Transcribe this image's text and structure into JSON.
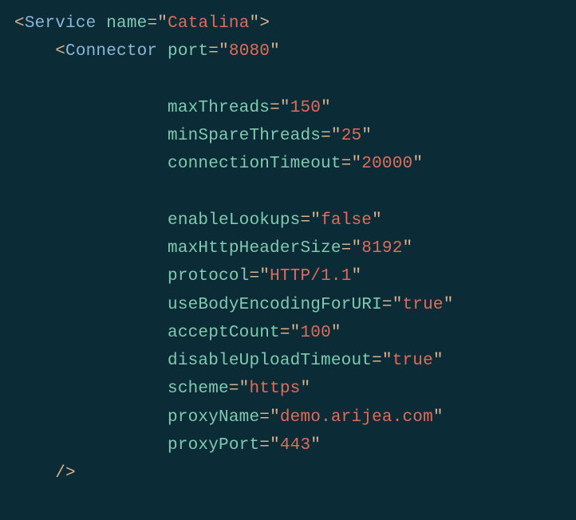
{
  "tokens": [
    {
      "cls": "p",
      "txt": "<"
    },
    {
      "cls": "t",
      "txt": "Service"
    },
    {
      "cls": "p",
      "txt": " "
    },
    {
      "cls": "a",
      "txt": "name"
    },
    {
      "cls": "p",
      "txt": "="
    },
    {
      "cls": "p",
      "txt": "\""
    },
    {
      "cls": "v",
      "txt": "Catalina"
    },
    {
      "cls": "p",
      "txt": "\""
    },
    {
      "cls": "p",
      "txt": ">"
    },
    {
      "cls": "nl",
      "txt": "\n"
    },
    {
      "cls": "p",
      "txt": "    <"
    },
    {
      "cls": "t",
      "txt": "Connector"
    },
    {
      "cls": "p",
      "txt": " "
    },
    {
      "cls": "a",
      "txt": "port"
    },
    {
      "cls": "p",
      "txt": "="
    },
    {
      "cls": "p",
      "txt": "\""
    },
    {
      "cls": "v",
      "txt": "8080"
    },
    {
      "cls": "p",
      "txt": "\""
    },
    {
      "cls": "nl",
      "txt": "\n"
    },
    {
      "cls": "nl",
      "txt": "\n"
    },
    {
      "cls": "p",
      "txt": "               "
    },
    {
      "cls": "a",
      "txt": "maxThreads"
    },
    {
      "cls": "p",
      "txt": "="
    },
    {
      "cls": "p",
      "txt": "\""
    },
    {
      "cls": "v",
      "txt": "150"
    },
    {
      "cls": "p",
      "txt": "\""
    },
    {
      "cls": "nl",
      "txt": "\n"
    },
    {
      "cls": "p",
      "txt": "               "
    },
    {
      "cls": "a",
      "txt": "minSpareThreads"
    },
    {
      "cls": "p",
      "txt": "="
    },
    {
      "cls": "p",
      "txt": "\""
    },
    {
      "cls": "v",
      "txt": "25"
    },
    {
      "cls": "p",
      "txt": "\""
    },
    {
      "cls": "nl",
      "txt": "\n"
    },
    {
      "cls": "p",
      "txt": "               "
    },
    {
      "cls": "a",
      "txt": "connectionTimeout"
    },
    {
      "cls": "p",
      "txt": "="
    },
    {
      "cls": "p",
      "txt": "\""
    },
    {
      "cls": "v",
      "txt": "20000"
    },
    {
      "cls": "p",
      "txt": "\""
    },
    {
      "cls": "nl",
      "txt": "\n"
    },
    {
      "cls": "nl",
      "txt": "\n"
    },
    {
      "cls": "p",
      "txt": "               "
    },
    {
      "cls": "a",
      "txt": "enableLookups"
    },
    {
      "cls": "p",
      "txt": "="
    },
    {
      "cls": "p",
      "txt": "\""
    },
    {
      "cls": "v",
      "txt": "false"
    },
    {
      "cls": "p",
      "txt": "\""
    },
    {
      "cls": "nl",
      "txt": "\n"
    },
    {
      "cls": "p",
      "txt": "               "
    },
    {
      "cls": "a",
      "txt": "maxHttpHeaderSize"
    },
    {
      "cls": "p",
      "txt": "="
    },
    {
      "cls": "p",
      "txt": "\""
    },
    {
      "cls": "v",
      "txt": "8192"
    },
    {
      "cls": "p",
      "txt": "\""
    },
    {
      "cls": "nl",
      "txt": "\n"
    },
    {
      "cls": "p",
      "txt": "               "
    },
    {
      "cls": "a",
      "txt": "protocol"
    },
    {
      "cls": "p",
      "txt": "="
    },
    {
      "cls": "p",
      "txt": "\""
    },
    {
      "cls": "v",
      "txt": "HTTP/1.1"
    },
    {
      "cls": "p",
      "txt": "\""
    },
    {
      "cls": "nl",
      "txt": "\n"
    },
    {
      "cls": "p",
      "txt": "               "
    },
    {
      "cls": "a",
      "txt": "useBodyEncodingForURI"
    },
    {
      "cls": "p",
      "txt": "="
    },
    {
      "cls": "p",
      "txt": "\""
    },
    {
      "cls": "v",
      "txt": "true"
    },
    {
      "cls": "p",
      "txt": "\""
    },
    {
      "cls": "nl",
      "txt": "\n"
    },
    {
      "cls": "p",
      "txt": "               "
    },
    {
      "cls": "a",
      "txt": "acceptCount"
    },
    {
      "cls": "p",
      "txt": "="
    },
    {
      "cls": "p",
      "txt": "\""
    },
    {
      "cls": "v",
      "txt": "100"
    },
    {
      "cls": "p",
      "txt": "\""
    },
    {
      "cls": "nl",
      "txt": "\n"
    },
    {
      "cls": "p",
      "txt": "               "
    },
    {
      "cls": "a",
      "txt": "disableUploadTimeout"
    },
    {
      "cls": "p",
      "txt": "="
    },
    {
      "cls": "p",
      "txt": "\""
    },
    {
      "cls": "v",
      "txt": "true"
    },
    {
      "cls": "p",
      "txt": "\""
    },
    {
      "cls": "nl",
      "txt": "\n"
    },
    {
      "cls": "p",
      "txt": "               "
    },
    {
      "cls": "a",
      "txt": "scheme"
    },
    {
      "cls": "p",
      "txt": "="
    },
    {
      "cls": "p",
      "txt": "\""
    },
    {
      "cls": "v",
      "txt": "https"
    },
    {
      "cls": "p",
      "txt": "\""
    },
    {
      "cls": "nl",
      "txt": "\n"
    },
    {
      "cls": "p",
      "txt": "               "
    },
    {
      "cls": "a",
      "txt": "proxyName"
    },
    {
      "cls": "p",
      "txt": "="
    },
    {
      "cls": "p",
      "txt": "\""
    },
    {
      "cls": "v",
      "txt": "demo.arijea.com"
    },
    {
      "cls": "p",
      "txt": "\""
    },
    {
      "cls": "nl",
      "txt": "\n"
    },
    {
      "cls": "p",
      "txt": "               "
    },
    {
      "cls": "a",
      "txt": "proxyPort"
    },
    {
      "cls": "p",
      "txt": "="
    },
    {
      "cls": "p",
      "txt": "\""
    },
    {
      "cls": "v",
      "txt": "443"
    },
    {
      "cls": "p",
      "txt": "\""
    },
    {
      "cls": "nl",
      "txt": "\n"
    },
    {
      "cls": "p",
      "txt": "    />"
    }
  ]
}
